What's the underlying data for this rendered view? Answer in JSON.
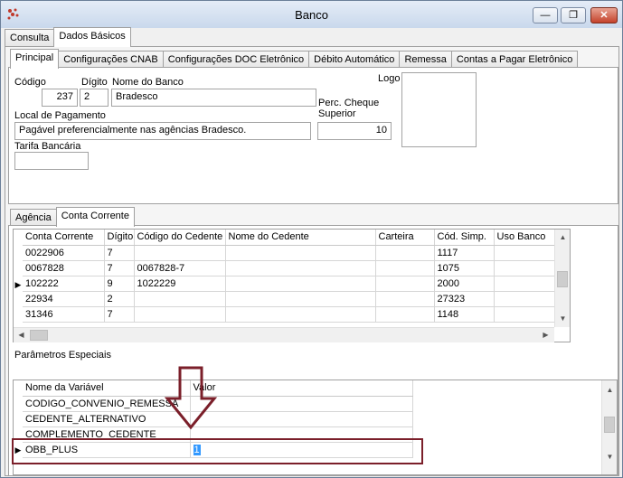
{
  "window": {
    "title": "Banco",
    "minimize": "—",
    "maximize": "❐",
    "close": "✕"
  },
  "main_tabs": [
    "Consulta",
    "Dados Básicos"
  ],
  "sub_tabs": [
    "Principal",
    "Configurações CNAB",
    "Configurações DOC Eletrônico",
    "Débito Automático",
    "Remessa",
    "Contas a Pagar Eletrônico"
  ],
  "form": {
    "codigo_label": "Código",
    "codigo_value": "237",
    "digito_label": "Dígito",
    "digito_value": "2",
    "nome_label": "Nome do Banco",
    "nome_value": "Bradesco",
    "logo_label": "Logo",
    "perc_label_1": "Perc. Cheque",
    "perc_label_2": "Superior",
    "perc_value": "10",
    "local_label": "Local de Pagamento",
    "local_value": "Pagável preferencialmente nas agências Bradesco.",
    "tarifa_label": "Tarifa Bancária",
    "tarifa_value": ""
  },
  "lower_tabs": [
    "Agência",
    "Conta Corrente"
  ],
  "accounts": {
    "columns": [
      "Conta Corrente",
      "Dígito",
      "Código do Cedente",
      "Nome do Cedente",
      "Carteira",
      "Cód. Simp.",
      "Uso Banco"
    ],
    "rows": [
      [
        "0022906",
        "7",
        "",
        "",
        "",
        "1117",
        ""
      ],
      [
        "0067828",
        "7",
        "0067828-7",
        "",
        "",
        "1075",
        ""
      ],
      [
        "102222",
        "9",
        "1022229",
        "",
        "",
        "2000",
        ""
      ],
      [
        "22934",
        "2",
        "",
        "",
        "",
        "27323",
        ""
      ],
      [
        "31346",
        "7",
        "",
        "",
        "",
        "1148",
        ""
      ]
    ],
    "current_row_marker": "▶"
  },
  "params": {
    "section_label": "Parâmetros Especiais",
    "columns": [
      "Nome da Variável",
      "Valor"
    ],
    "rows": [
      [
        "CODIGO_CONVENIO_REMESSA",
        ""
      ],
      [
        "CEDENTE_ALTERNATIVO",
        ""
      ],
      [
        "COMPLEMENTO_CEDENTE",
        ""
      ],
      [
        "OBB_PLUS",
        "1"
      ]
    ],
    "current_row_marker": "▶"
  },
  "colors": {
    "annotation": "#7b1f2a",
    "selection": "#3399ff"
  }
}
